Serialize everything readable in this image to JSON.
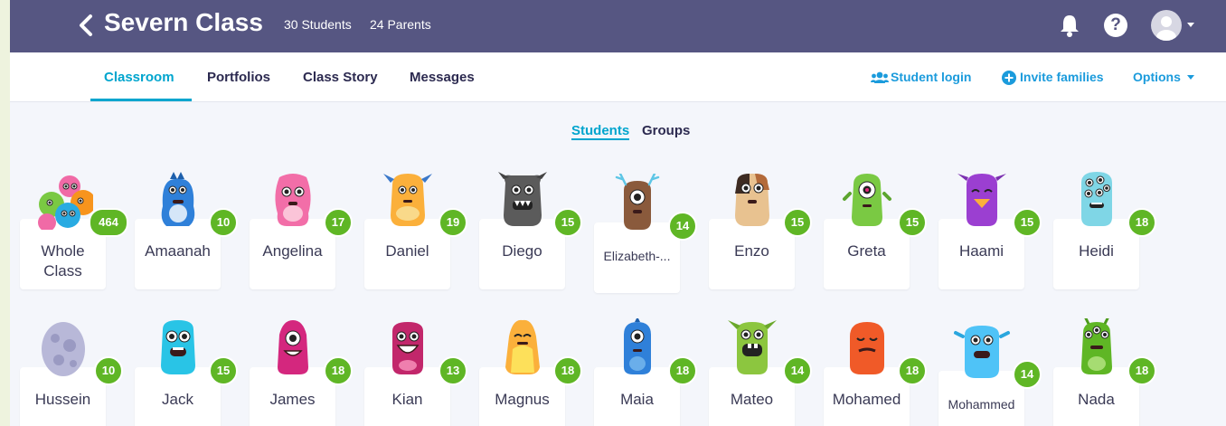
{
  "header": {
    "title": "Severn Class",
    "students_count": "30 Students",
    "parents_count": "24 Parents",
    "bar_color": "#565682"
  },
  "nav": {
    "tabs": [
      {
        "label": "Classroom",
        "active": true
      },
      {
        "label": "Portfolios"
      },
      {
        "label": "Class Story"
      },
      {
        "label": "Messages"
      }
    ],
    "student_login": "Student login",
    "invite_families": "Invite families",
    "options": "Options"
  },
  "view_toggle": {
    "students": "Students",
    "groups": "Groups"
  },
  "students": [
    {
      "name": "Whole Class",
      "points": "464",
      "monster": "group"
    },
    {
      "name": "Amaanah",
      "points": "10",
      "monster": "blue-tall"
    },
    {
      "name": "Angelina",
      "points": "17",
      "monster": "pink-fluffy"
    },
    {
      "name": "Daniel",
      "points": "19",
      "monster": "orange-horns"
    },
    {
      "name": "Diego",
      "points": "15",
      "monster": "grey-fanged"
    },
    {
      "name": "Elizabeth-...",
      "points": "14",
      "monster": "brown-antlers"
    },
    {
      "name": "Enzo",
      "points": "15",
      "monster": "patched-hamster"
    },
    {
      "name": "Greta",
      "points": "15",
      "monster": "green-one-eye"
    },
    {
      "name": "Haami",
      "points": "15",
      "monster": "purple-beak"
    },
    {
      "name": "Heidi",
      "points": "18",
      "monster": "teal-many-eyes"
    },
    {
      "name": "Hussein",
      "points": "10",
      "monster": "egg"
    },
    {
      "name": "Jack",
      "points": "15",
      "monster": "cyan-fluffy"
    },
    {
      "name": "James",
      "points": "18",
      "monster": "magenta-cyclops"
    },
    {
      "name": "Kian",
      "points": "13",
      "monster": "magenta-grin"
    },
    {
      "name": "Magnus",
      "points": "18",
      "monster": "yellow-flame"
    },
    {
      "name": "Maia",
      "points": "18",
      "monster": "blue-cyclops"
    },
    {
      "name": "Mateo",
      "points": "14",
      "monster": "lime-horns"
    },
    {
      "name": "Mohamed",
      "points": "18",
      "monster": "red-sleepy"
    },
    {
      "name": "Mohammed",
      "points": "14",
      "monster": "sky-fluffy"
    },
    {
      "name": "Nada",
      "points": "18",
      "monster": "green-three-eyes"
    }
  ],
  "colors": {
    "accent": "#00a5ce",
    "badge": "#5fb625",
    "link": "#1b9bdc"
  }
}
